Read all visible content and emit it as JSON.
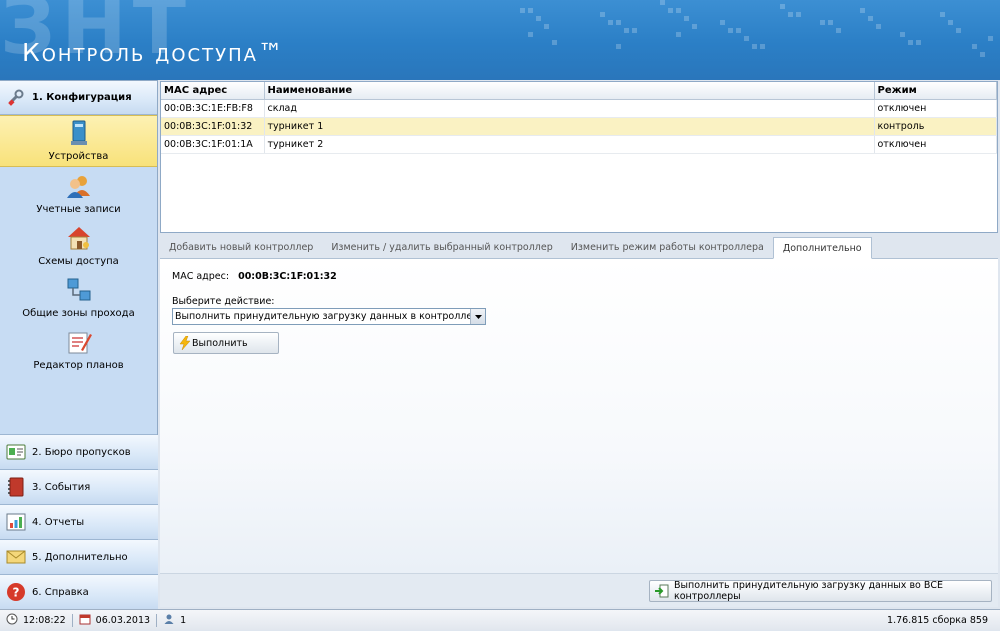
{
  "header": {
    "logo_mark": "ЗНТ",
    "app_title": "Контроль доступа™"
  },
  "sidebar": {
    "active_section": "1. Конфигурация",
    "items": [
      {
        "label": "Устройства",
        "icon": "computer-icon",
        "selected": true
      },
      {
        "label": "Учетные записи",
        "icon": "users-icon",
        "selected": false
      },
      {
        "label": "Схемы доступа",
        "icon": "house-key-icon",
        "selected": false
      },
      {
        "label": "Общие зоны прохода",
        "icon": "network-icon",
        "selected": false
      },
      {
        "label": "Редактор планов",
        "icon": "plan-editor-icon",
        "selected": false
      }
    ],
    "sections": [
      {
        "label": "2. Бюро пропусков",
        "icon": "id-card-icon"
      },
      {
        "label": "3. События",
        "icon": "journal-icon"
      },
      {
        "label": "4. Отчеты",
        "icon": "chart-icon"
      },
      {
        "label": "5. Дополнительно",
        "icon": "envelope-icon"
      },
      {
        "label": "6. Справка",
        "icon": "help-icon"
      }
    ]
  },
  "grid": {
    "columns": [
      "МАС адрес",
      "Наименование",
      "Режим"
    ],
    "rows": [
      {
        "mac": "00:0B:3C:1E:FB:F8",
        "name": "склад",
        "mode": "отключен"
      },
      {
        "mac": "00:0B:3C:1F:01:32",
        "name": "турникет 1",
        "mode": "контроль"
      },
      {
        "mac": "00:0B:3C:1F:01:1A",
        "name": "турникет 2",
        "mode": "отключен"
      }
    ],
    "selected_row": 1
  },
  "tabs": [
    "Добавить новый контроллер",
    "Изменить / удалить выбранный контроллер",
    "Изменить режим работы контроллера",
    "Дополнительно"
  ],
  "active_tab": 3,
  "panel": {
    "mac_label": "МАС адрес:",
    "mac_value": "00:0B:3C:1F:01:32",
    "action_label": "Выберите действие:",
    "action_value": "Выполнить принудительную загрузку данных в контроллер",
    "execute_label": "Выполнить",
    "all_button_label": "Выполнить принудительную загрузку данных во ВСЕ контроллеры"
  },
  "status": {
    "time": "12:08:22",
    "date": "06.03.2013",
    "users": "1",
    "version": "1.76.815 сборка 859"
  },
  "colors": {
    "header_blue": "#2b7fc6",
    "selected_yellow": "#f8e27a",
    "grid_selected": "#faf2c3"
  }
}
